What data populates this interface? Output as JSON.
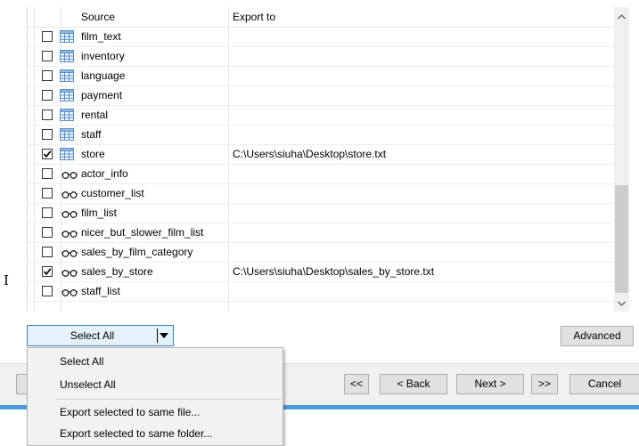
{
  "table": {
    "headers": {
      "source": "Source",
      "export_to": "Export to"
    },
    "rows": [
      {
        "name": "film_text",
        "type": "table",
        "checked": false,
        "export": ""
      },
      {
        "name": "inventory",
        "type": "table",
        "checked": false,
        "export": ""
      },
      {
        "name": "language",
        "type": "table",
        "checked": false,
        "export": ""
      },
      {
        "name": "payment",
        "type": "table",
        "checked": false,
        "export": ""
      },
      {
        "name": "rental",
        "type": "table",
        "checked": false,
        "export": ""
      },
      {
        "name": "staff",
        "type": "table",
        "checked": false,
        "export": ""
      },
      {
        "name": "store",
        "type": "table",
        "checked": true,
        "export": "C:\\Users\\siuha\\Desktop\\store.txt"
      },
      {
        "name": "actor_info",
        "type": "view",
        "checked": false,
        "export": ""
      },
      {
        "name": "customer_list",
        "type": "view",
        "checked": false,
        "export": ""
      },
      {
        "name": "film_list",
        "type": "view",
        "checked": false,
        "export": ""
      },
      {
        "name": "nicer_but_slower_film_list",
        "type": "view",
        "checked": false,
        "export": ""
      },
      {
        "name": "sales_by_film_category",
        "type": "view",
        "checked": false,
        "export": ""
      },
      {
        "name": "sales_by_store",
        "type": "view",
        "checked": true,
        "export": "C:\\Users\\siuha\\Desktop\\sales_by_store.txt"
      },
      {
        "name": "staff_list",
        "type": "view",
        "checked": false,
        "export": ""
      }
    ]
  },
  "controls": {
    "select_all_label": "Select All",
    "advanced_label": "Advanced"
  },
  "nav": {
    "first_label": "<<",
    "back_label": "< Back",
    "next_label": "Next >",
    "last_label": ">>",
    "cancel_label": "Cancel"
  },
  "menu": {
    "items": [
      "Select All",
      "Unselect All",
      "Export selected to same file...",
      "Export selected to same folder..."
    ]
  },
  "colors": {
    "accent_bar": "#4f9be0",
    "split_button_bg": "#e5f1fb",
    "split_button_border": "#3c7fb1"
  },
  "icons": {
    "table": "table-grid-icon",
    "view": "glasses-icon",
    "scroll_up": "chevron-up-icon",
    "scroll_down": "chevron-down-icon",
    "dropdown": "caret-down-icon",
    "cursor": "text-cursor-icon"
  }
}
